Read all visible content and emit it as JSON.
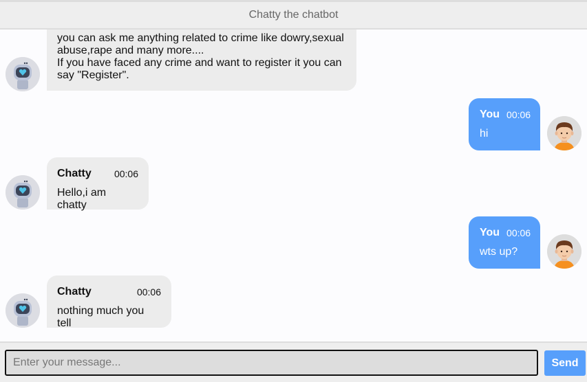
{
  "header": {
    "title": "Chatty the chatbot"
  },
  "messages": [
    {
      "side": "left",
      "name": "",
      "time": "",
      "lines": [
        "you can ask me anything related to crime like dowry,sexual",
        "abuse,rape and many more....",
        "If you have faced any crime and want to register it you can",
        "say \"Register\"."
      ],
      "avatar": "robot-icon"
    },
    {
      "side": "right",
      "name": "You",
      "time": "00:06",
      "text": "hi",
      "avatar": "user-avatar-icon"
    },
    {
      "side": "left",
      "name": "Chatty",
      "time": "00:06",
      "text": "Hello,i am chatty",
      "avatar": "robot-icon"
    },
    {
      "side": "right",
      "name": "You",
      "time": "00:06",
      "text": "wts up?",
      "avatar": "user-avatar-icon"
    },
    {
      "side": "left",
      "name": "Chatty",
      "time": "00:06",
      "text": "nothing much you tell",
      "avatar": "robot-icon"
    }
  ],
  "composer": {
    "placeholder": "Enter your message...",
    "send_label": "Send"
  },
  "colors": {
    "user_bubble": "#579ffb",
    "bot_bubble": "#ececec",
    "header_bg": "#eeeeee"
  }
}
